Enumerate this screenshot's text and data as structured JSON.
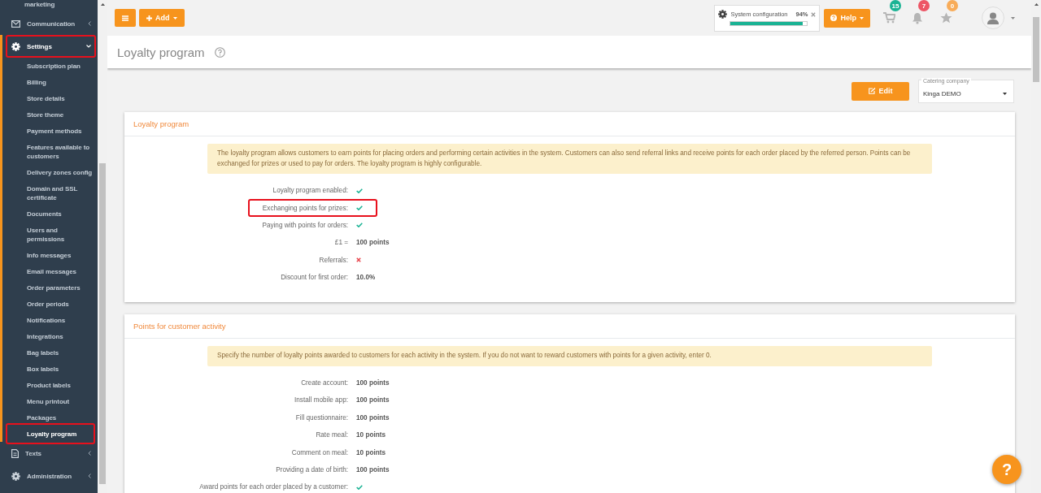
{
  "sidebar": {
    "items": [
      {
        "kind": "child",
        "label": "marketing",
        "selected": false,
        "highlighted": false
      },
      {
        "kind": "section",
        "label": "Communication",
        "expanded": false,
        "highlighted": false
      },
      {
        "kind": "section",
        "label": "Settings",
        "expanded": true,
        "highlighted": true,
        "children": [
          {
            "label": "Subscription plan",
            "selected": false,
            "highlighted": false
          },
          {
            "label": "Billing",
            "selected": false,
            "highlighted": false
          },
          {
            "label": "Store details",
            "selected": false,
            "highlighted": false
          },
          {
            "label": "Store theme",
            "selected": false,
            "highlighted": false
          },
          {
            "label": "Payment methods",
            "selected": false,
            "highlighted": false
          },
          {
            "label": "Features available to customers",
            "selected": false,
            "highlighted": false
          },
          {
            "label": "Delivery zones config",
            "selected": false,
            "highlighted": false
          },
          {
            "label": "Domain and SSL certificate",
            "selected": false,
            "highlighted": false
          },
          {
            "label": "Documents",
            "selected": false,
            "highlighted": false
          },
          {
            "label": "Users and permissions",
            "selected": false,
            "highlighted": false
          },
          {
            "label": "Info messages",
            "selected": false,
            "highlighted": false
          },
          {
            "label": "Email messages",
            "selected": false,
            "highlighted": false
          },
          {
            "label": "Order parameters",
            "selected": false,
            "highlighted": false
          },
          {
            "label": "Order periods",
            "selected": false,
            "highlighted": false
          },
          {
            "label": "Notifications",
            "selected": false,
            "highlighted": false
          },
          {
            "label": "Integrations",
            "selected": false,
            "highlighted": false
          },
          {
            "label": "Bag labels",
            "selected": false,
            "highlighted": false
          },
          {
            "label": "Box labels",
            "selected": false,
            "highlighted": false
          },
          {
            "label": "Product labels",
            "selected": false,
            "highlighted": false
          },
          {
            "label": "Menu printout",
            "selected": false,
            "highlighted": false
          },
          {
            "label": "Packages",
            "selected": false,
            "highlighted": false
          },
          {
            "label": "Loyalty program",
            "selected": true,
            "highlighted": true
          }
        ]
      },
      {
        "kind": "section",
        "label": "Texts",
        "expanded": false,
        "highlighted": false
      },
      {
        "kind": "section",
        "label": "Administration",
        "expanded": false,
        "highlighted": false
      }
    ]
  },
  "topbar": {
    "add_button": "Add",
    "config": {
      "label": "System configuration",
      "percent": "94%",
      "level": 0.94
    },
    "help_button": "Help",
    "badges": [
      {
        "count": "15",
        "color": "#1ab394"
      },
      {
        "count": "7",
        "color": "#ed5565"
      },
      {
        "count": "0",
        "color": "#f8ac59"
      }
    ]
  },
  "page_title": "Loyalty program",
  "toolbar": {
    "edit_button": "Edit",
    "company_select": {
      "label": "Catering company",
      "value": "Kinga DEMO"
    }
  },
  "panels": [
    {
      "title": "Loyalty program",
      "info": "The loyalty program allows customers to earn points for placing orders and performing certain activities in the system. Customers can also send referral links and receive points for each order placed by the referred person. Points can be exchanged for prizes or used to pay for orders. The loyalty program is highly configurable.",
      "rows": [
        {
          "kind": "check",
          "label": "Loyalty program enabled:",
          "checked": true,
          "highlighted": false
        },
        {
          "kind": "check",
          "label": "Exchanging points for prizes:",
          "checked": true,
          "highlighted": true
        },
        {
          "kind": "check",
          "label": "Paying with points for orders:",
          "checked": true,
          "highlighted": false
        },
        {
          "kind": "text",
          "label": "£1 =",
          "value": "100 points",
          "highlighted": false
        },
        {
          "kind": "check",
          "label": "Referrals:",
          "checked": false,
          "highlighted": false
        },
        {
          "kind": "text",
          "label": "Discount for first order:",
          "value": "10.0%",
          "highlighted": false
        }
      ]
    },
    {
      "title": "Points for customer activity",
      "info": "Specify the number of loyalty points awarded to customers for each activity in the system. If you do not want to reward customers with points for a given activity, enter 0.",
      "rows": [
        {
          "kind": "text",
          "label": "Create account:",
          "value": "100 points",
          "highlighted": false
        },
        {
          "kind": "text",
          "label": "Install mobile app:",
          "value": "100 points",
          "highlighted": false
        },
        {
          "kind": "text",
          "label": "Fill questionnaire:",
          "value": "100 points",
          "highlighted": false
        },
        {
          "kind": "text",
          "label": "Rate meal:",
          "value": "10 points",
          "highlighted": false
        },
        {
          "kind": "text",
          "label": "Comment on meal:",
          "value": "10 points",
          "highlighted": false
        },
        {
          "kind": "text",
          "label": "Providing a date of birth:",
          "value": "100 points",
          "highlighted": false
        },
        {
          "kind": "check",
          "label": "Award points for each order placed by a customer:",
          "checked": true,
          "highlighted": false
        }
      ]
    }
  ],
  "help_bubble": "?"
}
